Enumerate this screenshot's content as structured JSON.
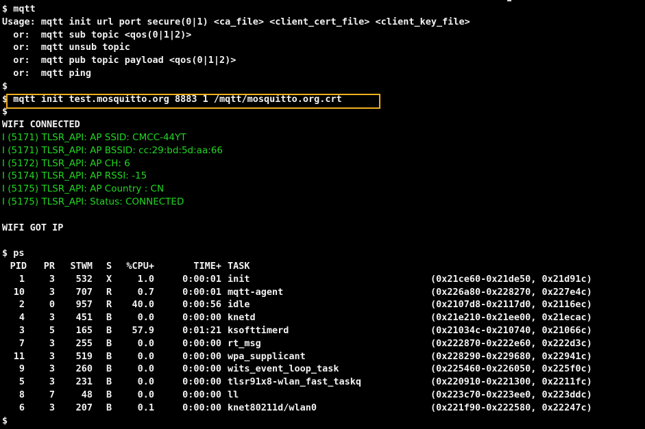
{
  "terminal": {
    "lines_top": [
      "$ mqtt",
      "Usage: mqtt init url port secure(0|1) <ca_file> <client_cert_file> <client_key_file>",
      "  or:  mqtt sub topic <qos(0|1|2)>",
      "  or:  mqtt unsub topic",
      "  or:  mqtt pub topic payload <qos(0|1|2)>",
      "  or:  mqtt ping",
      "$",
      "$ mqtt init test.mosquitto.org 8883 1 /mqtt/mosquitto.org.crt",
      "$",
      "WIFI CONNECTED"
    ],
    "log_lines": [
      "I (5171) TLSR_API: AP SSID: CMCC-44YT",
      "I (5171) TLSR_API: AP BSSID: cc:29:bd:5d:aa:66",
      "I (5172) TLSR_API: AP CH: 6",
      "I (5174) TLSR_API: AP RSSI: -15",
      "I (5175) TLSR_API: AP Country : CN",
      "I (5175) TLSR_API: Status: CONNECTED"
    ],
    "got_ip": "WIFI GOT IP",
    "ps_command": "$ ps",
    "ps_header": {
      "pid": "PID",
      "pr": "PR",
      "stwm": "STWM",
      "s": "S",
      "cpu": "%CPU+",
      "time": "TIME+",
      "task": "TASK"
    },
    "ps_rows": [
      {
        "pid": "1",
        "pr": "3",
        "stwm": "532",
        "s": "X",
        "cpu": "1.0",
        "time": "0:00:01",
        "task": "init",
        "addr": "(0x21ce60-0x21de50, 0x21d91c)"
      },
      {
        "pid": "10",
        "pr": "3",
        "stwm": "707",
        "s": "R",
        "cpu": "0.7",
        "time": "0:00:01",
        "task": "mqtt-agent",
        "addr": "(0x226a80-0x228270, 0x227e4c)"
      },
      {
        "pid": "2",
        "pr": "0",
        "stwm": "957",
        "s": "R",
        "cpu": "40.0",
        "time": "0:00:56",
        "task": "idle",
        "addr": "(0x2107d8-0x2117d0, 0x2116ec)"
      },
      {
        "pid": "4",
        "pr": "3",
        "stwm": "451",
        "s": "B",
        "cpu": "0.0",
        "time": "0:00:00",
        "task": "knetd",
        "addr": "(0x21e210-0x21ee00, 0x21ecac)"
      },
      {
        "pid": "3",
        "pr": "5",
        "stwm": "165",
        "s": "B",
        "cpu": "57.9",
        "time": "0:01:21",
        "task": "ksofttimerd",
        "addr": "(0x21034c-0x210740, 0x21066c)"
      },
      {
        "pid": "7",
        "pr": "3",
        "stwm": "255",
        "s": "B",
        "cpu": "0.0",
        "time": "0:00:00",
        "task": "rt_msg",
        "addr": "(0x222870-0x222e60, 0x222d3c)"
      },
      {
        "pid": "11",
        "pr": "3",
        "stwm": "519",
        "s": "B",
        "cpu": "0.0",
        "time": "0:00:00",
        "task": "wpa_supplicant",
        "addr": "(0x228290-0x229680, 0x22941c)"
      },
      {
        "pid": "9",
        "pr": "3",
        "stwm": "260",
        "s": "B",
        "cpu": "0.0",
        "time": "0:00:00",
        "task": "wits_event_loop_task",
        "addr": "(0x225460-0x226050, 0x225f0c)"
      },
      {
        "pid": "5",
        "pr": "3",
        "stwm": "231",
        "s": "B",
        "cpu": "0.0",
        "time": "0:00:00",
        "task": "tlsr91x8-wlan_fast_taskq",
        "addr": "(0x220910-0x221300, 0x2211fc)"
      },
      {
        "pid": "8",
        "pr": "7",
        "stwm": "48",
        "s": "B",
        "cpu": "0.0",
        "time": "0:00:00",
        "task": "ll",
        "addr": "(0x223c70-0x223ee0, 0x223ddc)"
      },
      {
        "pid": "6",
        "pr": "3",
        "stwm": "207",
        "s": "B",
        "cpu": "0.1",
        "time": "0:00:00",
        "task": "knet80211d/wlan0",
        "addr": "(0x221f90-0x222580, 0x22247c)"
      }
    ],
    "final_prompt": "$",
    "colors": {
      "background": "#000000",
      "text": "#f2f2f2",
      "log_green": "#22d622",
      "highlight_box": "#f0b020"
    }
  }
}
